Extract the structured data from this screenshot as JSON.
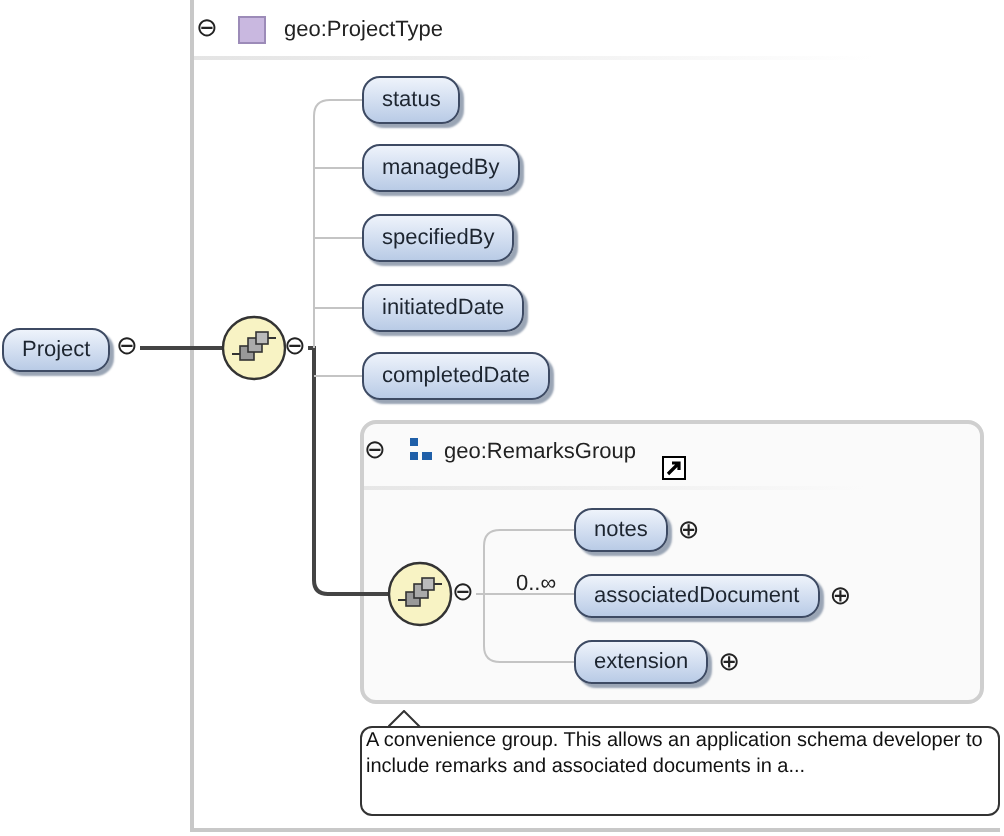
{
  "type_box": {
    "title": "geo:ProjectType",
    "collapse_symbol": "⊖"
  },
  "root": {
    "label": "Project",
    "collapse_symbol": "⊖"
  },
  "sequence": {
    "collapse_symbol": "⊖"
  },
  "elements": [
    {
      "label": "status"
    },
    {
      "label": "managedBy"
    },
    {
      "label": "specifiedBy"
    },
    {
      "label": "initiatedDate"
    },
    {
      "label": "completedDate"
    }
  ],
  "group": {
    "title": "geo:RemarksGroup",
    "collapse_symbol": "⊖",
    "sequence_collapse_symbol": "⊖",
    "occurrence": "0..∞",
    "elements": [
      {
        "label": "notes",
        "expand_symbol": "⊕"
      },
      {
        "label": "associatedDocument",
        "expand_symbol": "⊕"
      },
      {
        "label": "extension",
        "expand_symbol": "⊕"
      }
    ]
  },
  "tooltip": {
    "text": "A convenience group. This allows an application schema developer to include remarks and associated documents in a..."
  }
}
